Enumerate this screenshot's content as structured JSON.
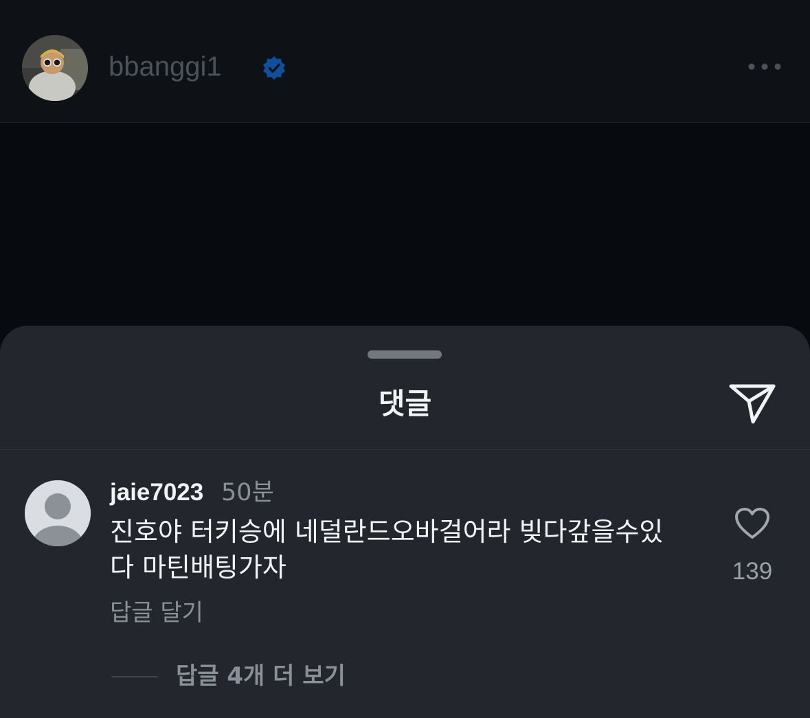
{
  "post": {
    "username": "bbanggi1",
    "verified": true
  },
  "comments_sheet": {
    "title": "댓글",
    "comment": {
      "username": "jaie7023",
      "time": "50분",
      "text": "진호야 터키승에 네덜란드오바걸어라 빚다갚을수있\n다 마틴배팅가자",
      "likes": "139",
      "reply_label": "답글 달기",
      "view_replies_label": "답글 4개 더 보기"
    }
  },
  "icons": [
    "avatar",
    "verified-badge-icon",
    "more-icon",
    "share-icon",
    "heart-icon"
  ],
  "colors": {
    "background": "#0b0f14",
    "sheet": "#23272d",
    "verified": "#0f6fe0",
    "muted_text": "#8a9099"
  }
}
